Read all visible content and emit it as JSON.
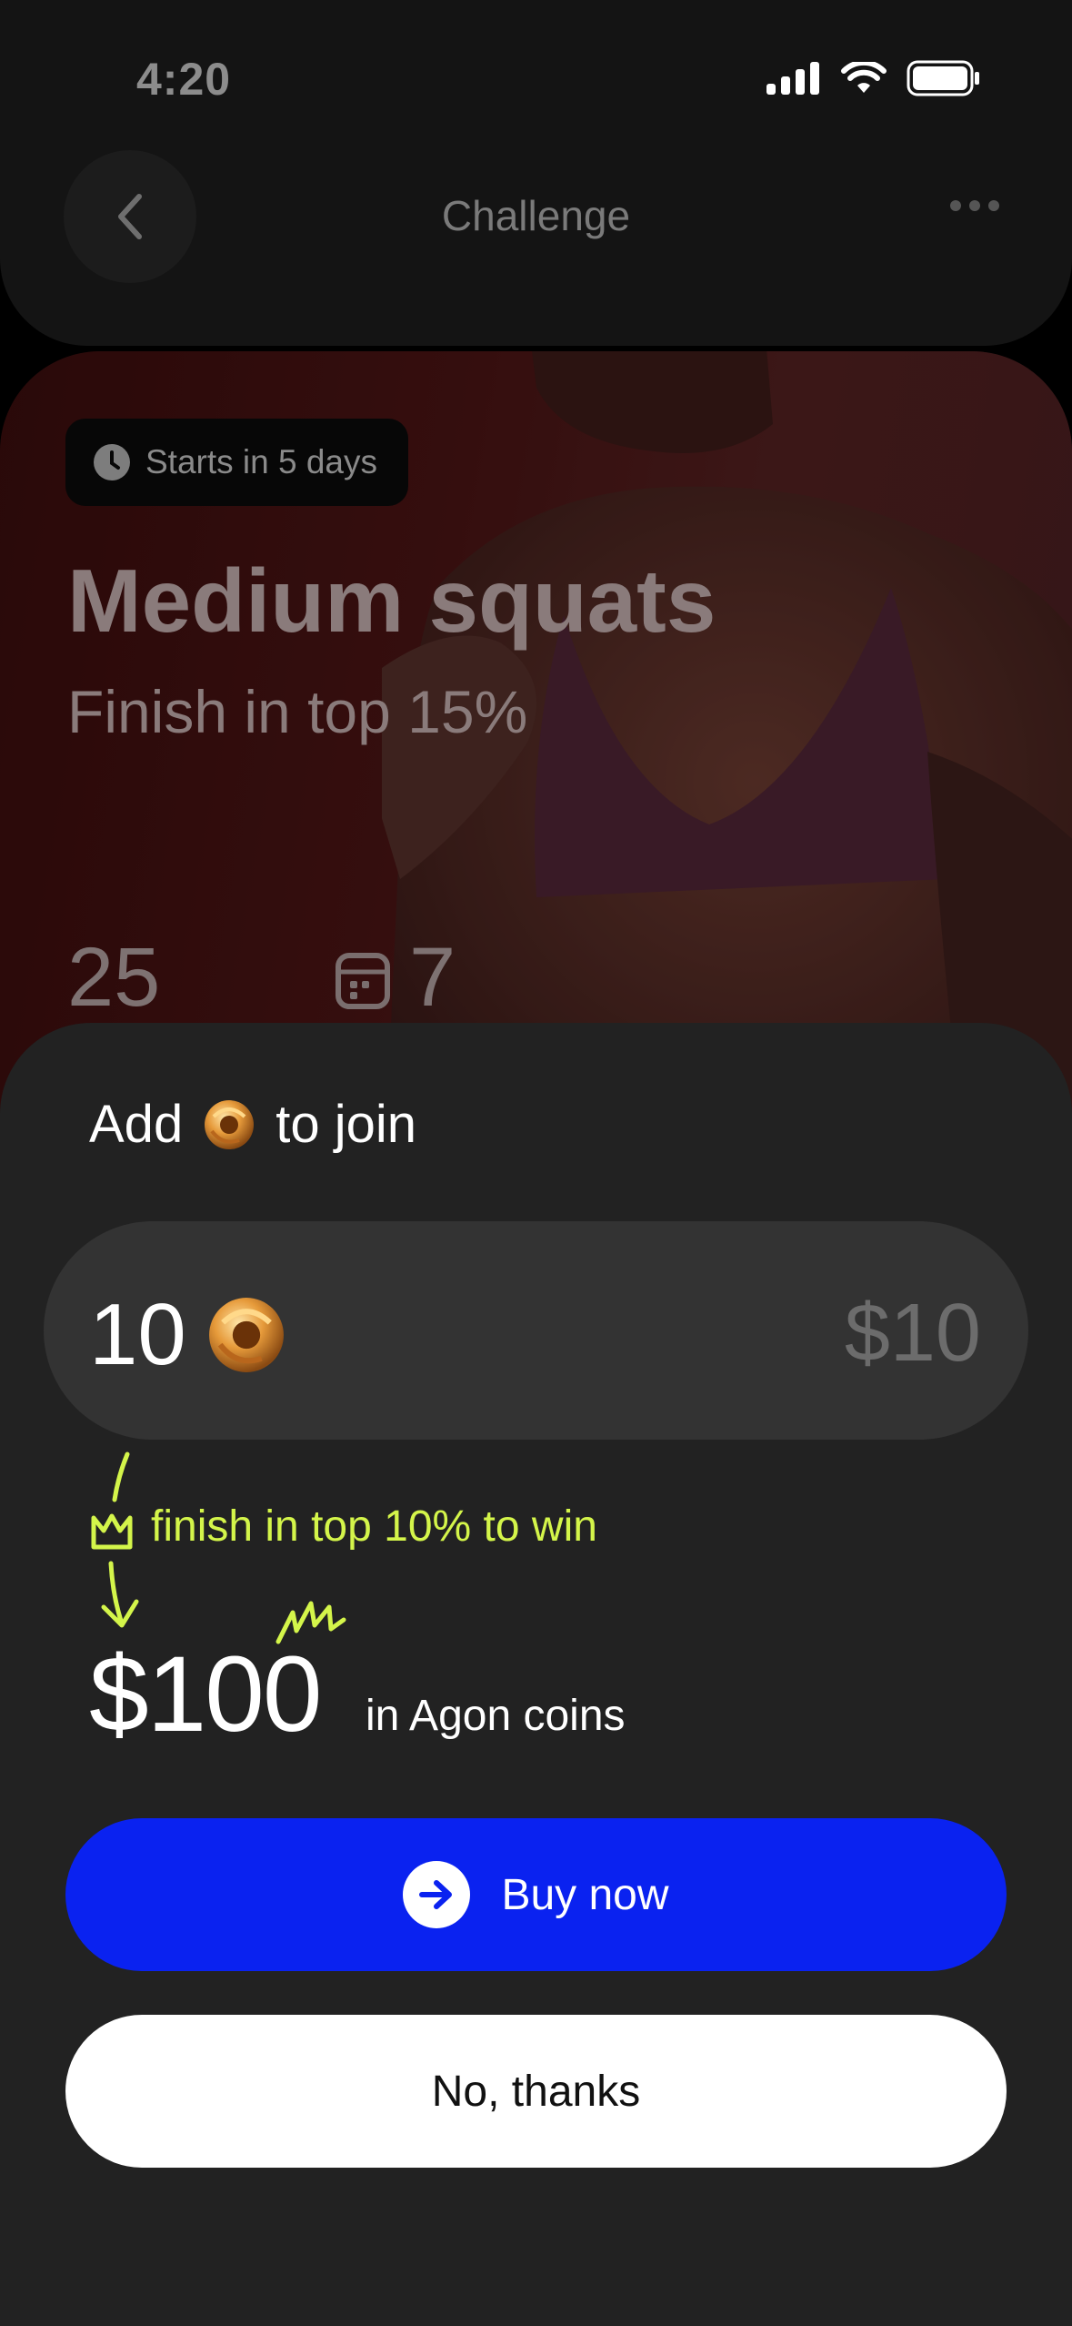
{
  "status_bar": {
    "time": "4:20",
    "icons": [
      "signal-icon",
      "wifi-icon",
      "battery-icon"
    ]
  },
  "header": {
    "title": "Challenge",
    "back_icon": "chevron-left-icon",
    "more_icon": "more-dots-icon"
  },
  "hero": {
    "badge_icon": "clock-icon",
    "badge_text": "Starts in 5 days",
    "title": "Medium squats",
    "subtitle": "Finish in top 15%",
    "stat_a": "25",
    "stat_b_icon": "calendar-icon",
    "stat_b": "7"
  },
  "sheet": {
    "title_prefix": "Add",
    "title_suffix": "to join",
    "coin_icon": "agon-coin-icon",
    "amount": "10",
    "amount_usd": "$10",
    "win_note": "finish in top 10% to win",
    "win_note_icon": "crown-icon",
    "prize": "$100",
    "prize_caption": "in Agon coins",
    "buy_label": "Buy now",
    "buy_icon": "arrow-right-icon",
    "decline_label": "No, thanks"
  },
  "colors": {
    "accent_blue": "#0a22f0",
    "highlight_green": "#d4f54a",
    "sheet_bg": "#222222"
  }
}
